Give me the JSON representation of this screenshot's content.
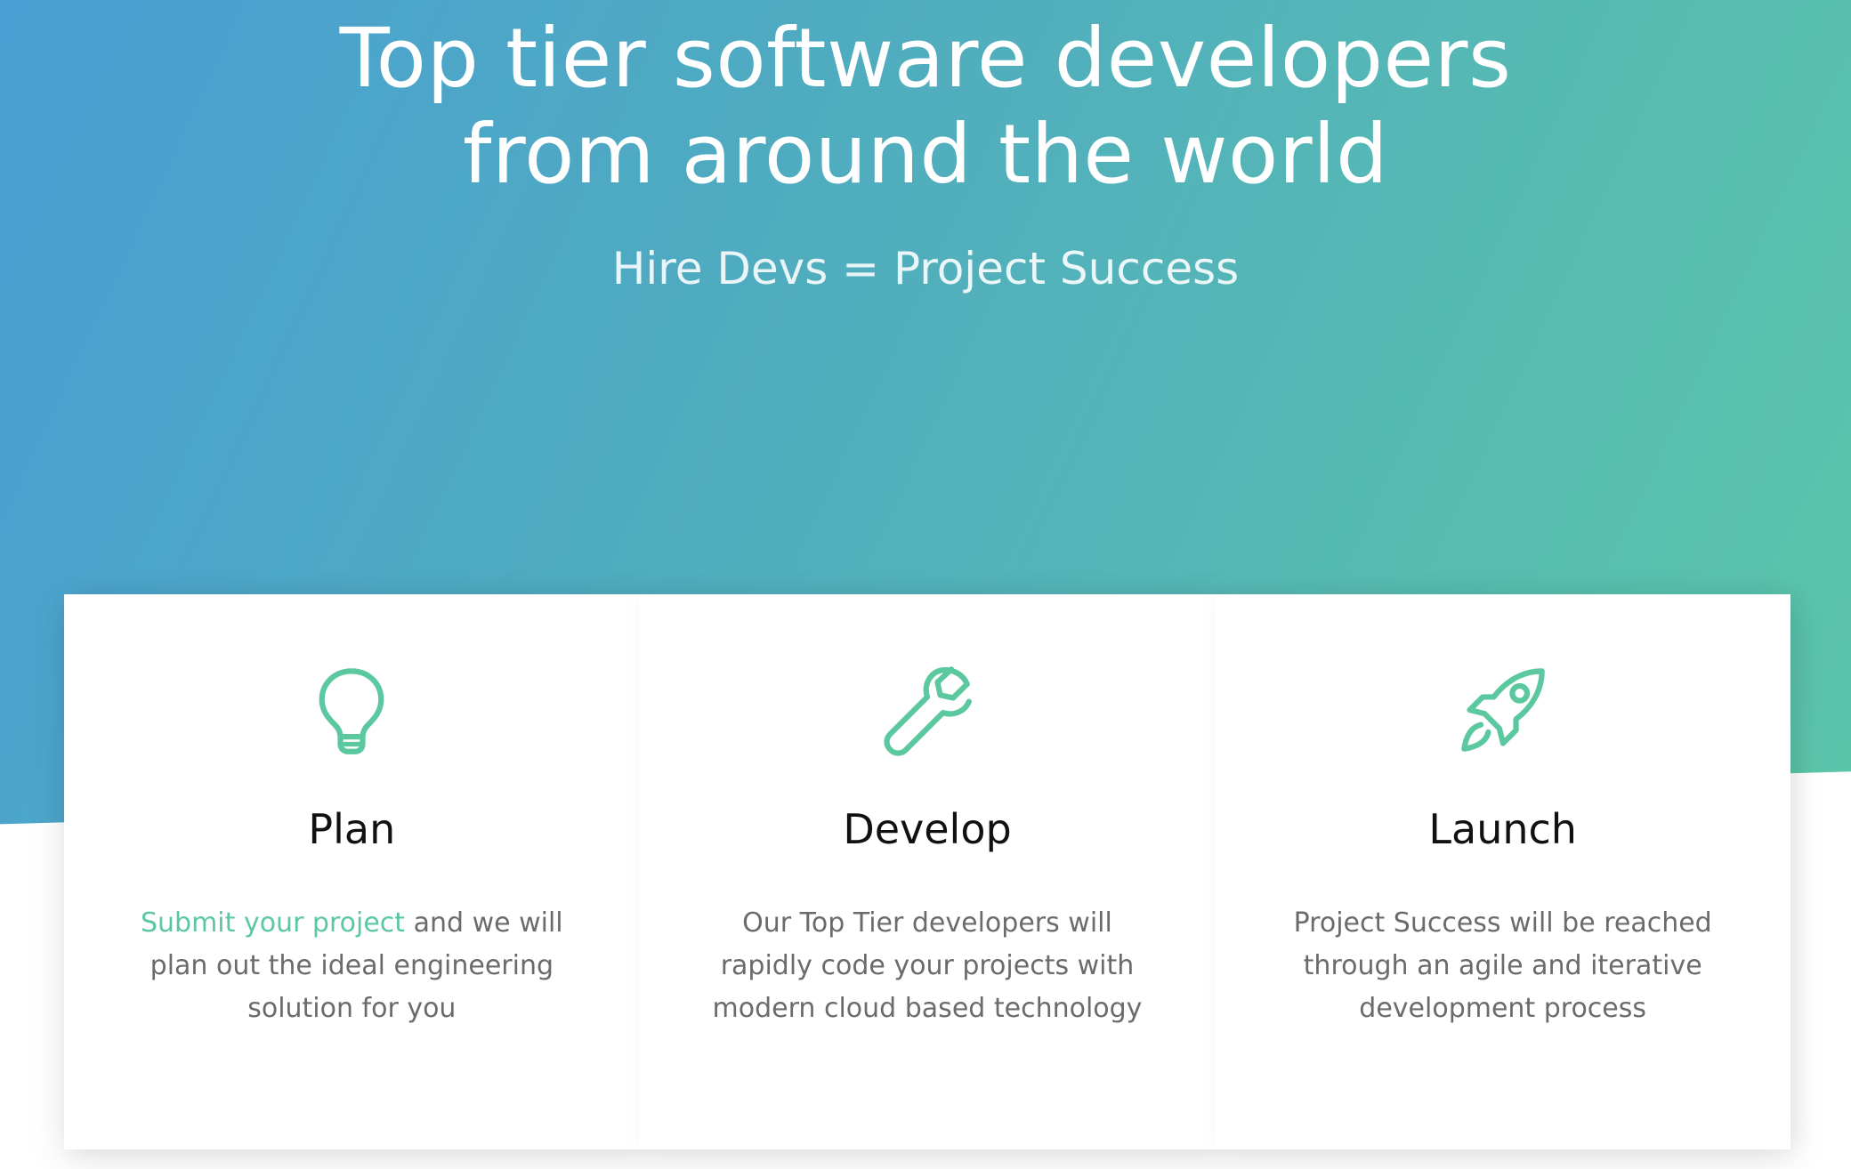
{
  "hero": {
    "title_line1": "Top tier software developers",
    "title_line2": "from around the world",
    "subtitle": "Hire Devs = Project Success"
  },
  "cards": [
    {
      "icon": "lightbulb-icon",
      "title": "Plan",
      "link_text": "Submit your project",
      "text": " and we will plan out the ideal engineering solution for you"
    },
    {
      "icon": "wrench-icon",
      "title": "Develop",
      "text": "Our Top Tier developers will rapidly code your projects with modern cloud based technology"
    },
    {
      "icon": "rocket-icon",
      "title": "Launch",
      "text": "Project Success will be reached through an agile and iterative development process"
    }
  ],
  "colors": {
    "gradient_start": "#4a9fd4",
    "gradient_end": "#5ec8a6",
    "accent": "#5cc8a0",
    "body_text": "#6b6b6b",
    "title_text": "#111111"
  }
}
